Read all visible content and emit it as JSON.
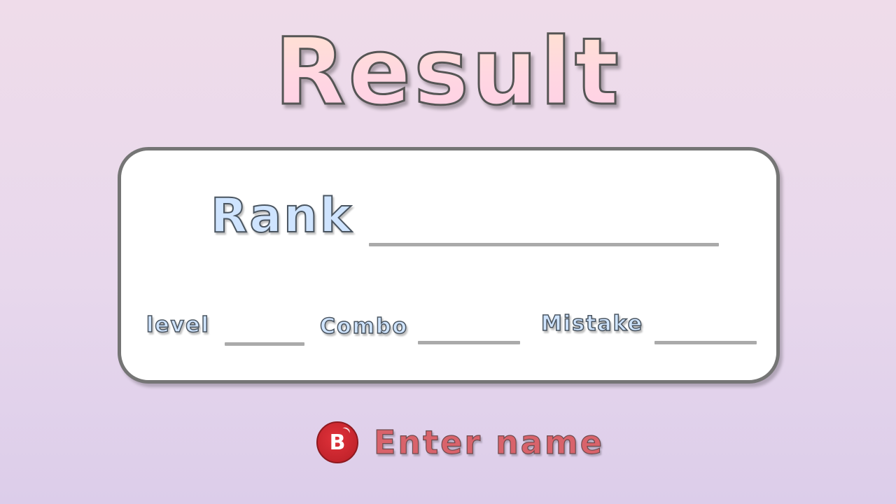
{
  "screen": {
    "title": "Result"
  },
  "panel": {
    "rank_label": "Rank",
    "rank_value": "",
    "stats": {
      "level_label": "level",
      "level_value": "",
      "combo_label": "Combo",
      "combo_value": "",
      "mistake_label": "Mistake",
      "mistake_value": ""
    }
  },
  "prompt": {
    "button_glyph": "B",
    "button_icon": "b-button-icon",
    "label": "Enter name"
  },
  "colors": {
    "title_fill": "#ffd6e2",
    "label_fill": "#cfe4ff",
    "button_red": "#c4242c",
    "prompt_text": "#d9636b",
    "panel_border": "#757575"
  }
}
